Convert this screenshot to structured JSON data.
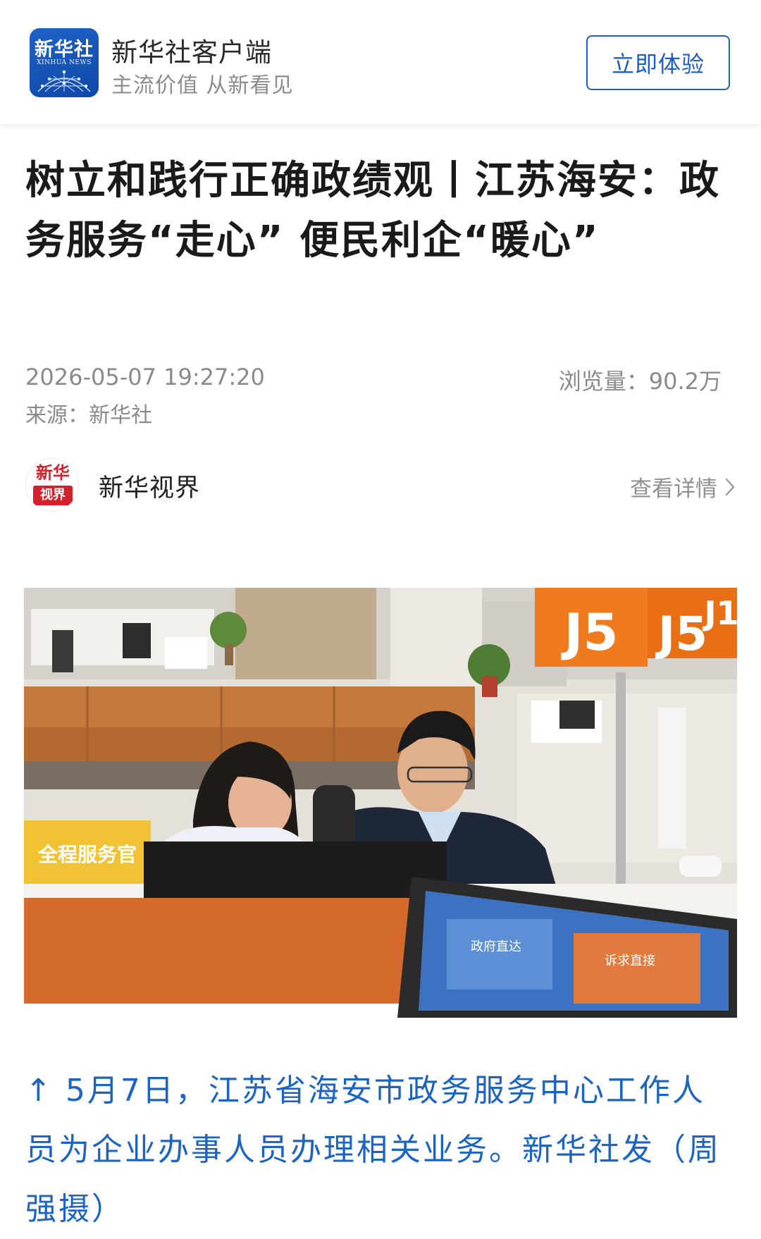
{
  "header": {
    "logo_main": "新华社",
    "logo_sub": "XINHUA NEWS",
    "app_name": "新华社客户端",
    "slogan": "主流价值 从新看见",
    "try_button_label": "立即体验"
  },
  "article": {
    "headline": "树立和践行正确政绩观丨江苏海安：政务服务“走心” 便民利企“暖心”",
    "publish_time": "2026-05-07 19:27:20",
    "view_count": "浏览量：90.2万",
    "source": "来源：新华社"
  },
  "channel": {
    "avatar_top": "新华",
    "avatar_bottom": "视界",
    "name": "新华视界",
    "view_detail_label": "查看详情"
  },
  "photo": {
    "counter_sign_1": "J5",
    "counter_sign_2": "J5",
    "counter_sign_3": "J1",
    "desk_sign": "全程服务官",
    "screen_text_1": "政府直达",
    "screen_text_2": "诉求直接"
  },
  "caption": {
    "text": "↑ 5月7日，江苏省海安市政务服务中心工作人员为企业办事人员办理相关业务。新华社发（周强摄）"
  },
  "colors": {
    "brand_blue": "#1b5fc4",
    "caption_blue": "#1c64c2",
    "sign_orange": "#f07a1e",
    "avatar_red": "#d4202a"
  }
}
